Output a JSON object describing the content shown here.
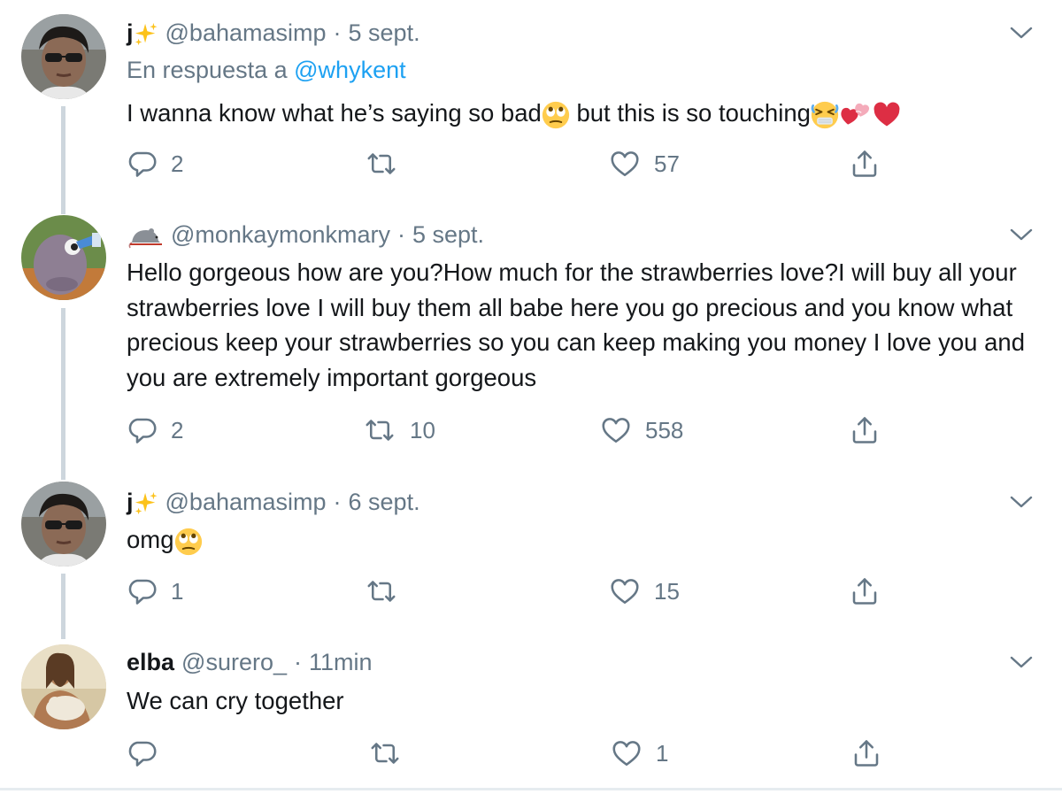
{
  "tweets": [
    {
      "name": "j",
      "handle": "@bahamasimp",
      "dot": "·",
      "time": "5 sept.",
      "reply_prefix": "En respuesta a",
      "reply_to": "@whykent",
      "text_a": "I wanna know what he’s saying so bad",
      "text_b": " but this is so touching",
      "replies": "2",
      "retweets": "",
      "likes": "57"
    },
    {
      "name": "",
      "handle": "@monkaymonkmary",
      "dot": "·",
      "time": "5 sept.",
      "text": "Hello gorgeous how are you?How much for the strawberries love?I will buy all your strawberries love I will buy them all babe here you go precious and you know what precious keep your strawberries so you can keep making you money I love you and you are extremely important gorgeous",
      "replies": "2",
      "retweets": "10",
      "likes": "558"
    },
    {
      "name": "j",
      "handle": "@bahamasimp",
      "dot": "·",
      "time": "6 sept.",
      "text": "omg",
      "replies": "1",
      "retweets": "",
      "likes": "15"
    },
    {
      "name": "elba",
      "handle": "@surero_",
      "dot": "·",
      "time": "11min",
      "text": "We can cry together",
      "replies": "",
      "retweets": "",
      "likes": "1"
    }
  ],
  "icons": {
    "reply": "reply-icon",
    "retweet": "retweet-icon",
    "like": "heart-icon",
    "share": "share-icon",
    "more": "chevron-down-icon"
  },
  "colors": {
    "text": "#14171a",
    "secondary": "#657786",
    "link": "#1da1f2",
    "thread_line": "#cdd6dd"
  }
}
